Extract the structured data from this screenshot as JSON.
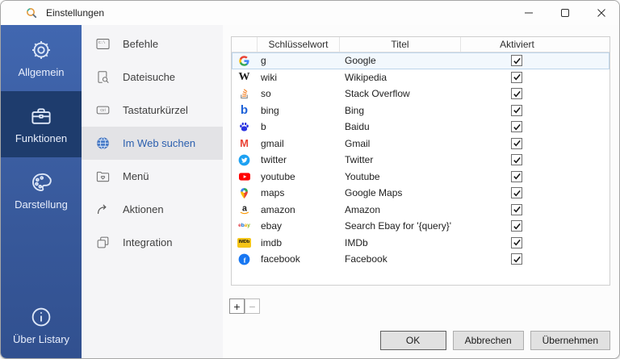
{
  "titlebar": {
    "title": "Einstellungen",
    "logo_icon": "listary-logo-icon",
    "controls": [
      {
        "name": "minimize",
        "icon": "minimize-icon"
      },
      {
        "name": "maximize",
        "icon": "maximize-icon"
      },
      {
        "name": "close",
        "icon": "close-icon"
      }
    ]
  },
  "sidebar": {
    "items": [
      {
        "label": "Allgemein",
        "icon": "gear-icon",
        "selected": false
      },
      {
        "label": "Funktionen",
        "icon": "briefcase-icon",
        "selected": true
      },
      {
        "label": "Darstellung",
        "icon": "palette-icon",
        "selected": false
      }
    ],
    "footer": {
      "label": "Über Listary",
      "icon": "info-icon"
    }
  },
  "menu": {
    "items": [
      {
        "label": "Befehle",
        "icon": "command-window-icon",
        "selected": false
      },
      {
        "label": "Dateisuche",
        "icon": "file-search-icon",
        "selected": false
      },
      {
        "label": "Tastaturkürzel",
        "icon": "ctrl-key-icon",
        "selected": false
      },
      {
        "label": "Im Web suchen",
        "icon": "globe-icon",
        "selected": true
      },
      {
        "label": "Menü",
        "icon": "folder-heart-icon",
        "selected": false
      },
      {
        "label": "Aktionen",
        "icon": "share-arrow-icon",
        "selected": false
      },
      {
        "label": "Integration",
        "icon": "integration-icon",
        "selected": false
      }
    ]
  },
  "content": {
    "table": {
      "columns": [
        "",
        "Schlüsselwort",
        "Titel",
        "Aktiviert"
      ],
      "rows": [
        {
          "icon": "google-icon",
          "keyword": "g",
          "title": "Google",
          "enabled": true,
          "selected": true
        },
        {
          "icon": "wikipedia-icon",
          "keyword": "wiki",
          "title": "Wikipedia",
          "enabled": true,
          "selected": false
        },
        {
          "icon": "stackoverflow-icon",
          "keyword": "so",
          "title": "Stack Overflow",
          "enabled": true,
          "selected": false
        },
        {
          "icon": "bing-icon",
          "keyword": "bing",
          "title": "Bing",
          "enabled": true,
          "selected": false
        },
        {
          "icon": "baidu-icon",
          "keyword": "b",
          "title": "Baidu",
          "enabled": true,
          "selected": false
        },
        {
          "icon": "gmail-icon",
          "keyword": "gmail",
          "title": "Gmail",
          "enabled": true,
          "selected": false
        },
        {
          "icon": "twitter-icon",
          "keyword": "twitter",
          "title": "Twitter",
          "enabled": true,
          "selected": false
        },
        {
          "icon": "youtube-icon",
          "keyword": "youtube",
          "title": "Youtube",
          "enabled": true,
          "selected": false
        },
        {
          "icon": "maps-icon",
          "keyword": "maps",
          "title": "Google Maps",
          "enabled": true,
          "selected": false
        },
        {
          "icon": "amazon-icon",
          "keyword": "amazon",
          "title": "Amazon",
          "enabled": true,
          "selected": false
        },
        {
          "icon": "ebay-icon",
          "keyword": "ebay",
          "title": "Search Ebay for '{query}'",
          "enabled": true,
          "selected": false
        },
        {
          "icon": "imdb-icon",
          "keyword": "imdb",
          "title": "IMDb",
          "enabled": true,
          "selected": false
        },
        {
          "icon": "facebook-icon",
          "keyword": "facebook",
          "title": "Facebook",
          "enabled": true,
          "selected": false
        }
      ]
    },
    "add_button": "+",
    "remove_button": "−"
  },
  "footer": {
    "ok": "OK",
    "cancel": "Abbrechen",
    "apply": "Übernehmen"
  },
  "colors": {
    "sidebar_selected": "#1e3c6d",
    "accent": "#2b5fae",
    "menu_selected_bg": "#e3e3e6",
    "row_selected_bg": "#f2f8fd",
    "row_selected_border": "#bdd5eb",
    "brands": {
      "google_blue": "#4285F4",
      "google_red": "#EA4335",
      "google_yellow": "#FBBC04",
      "google_green": "#34A853",
      "wikipedia": "#1b1b1b",
      "stackoverflow_orange": "#F48024",
      "stackoverflow_gray": "#8e8e8e",
      "bing": "#1E62D8",
      "baidu": "#2932E1",
      "gmail": "#EA4335",
      "twitter": "#1DA1F2",
      "youtube": "#FF0000",
      "amazon": "#1b1b1b",
      "amazon_orange": "#FF9900",
      "ebay_e": "#E53238",
      "ebay_b": "#0064D2",
      "ebay_a": "#F5AF02",
      "ebay_y": "#86B817",
      "imdb": "#F5C518",
      "facebook": "#1877F2"
    }
  }
}
